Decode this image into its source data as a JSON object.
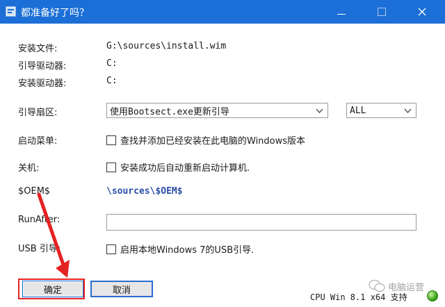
{
  "window": {
    "title": "都准备好了吗？"
  },
  "info": [
    {
      "label": "安装文件:",
      "value": "G:\\sources\\install.wim"
    },
    {
      "label": "引导驱动器:",
      "value": "C:"
    },
    {
      "label": "安装驱动器:",
      "value": "C:"
    }
  ],
  "boot_sector": {
    "label": "引导扇区:",
    "method_selected": "使用Bootsect.exe更新引导",
    "target_selected": "ALL"
  },
  "boot_menu": {
    "label": "启动菜单:",
    "checkbox_text": "查找并添加已经安装在此电脑的Windows版本",
    "checked": false
  },
  "shutdown": {
    "label": "关机:",
    "checkbox_text": "安装成功后自动重新启动计算机.",
    "checked": false
  },
  "oem": {
    "label": "$OEM$",
    "value": "\\sources\\$OEM$"
  },
  "runafter": {
    "label": "RunAfter:",
    "value": ""
  },
  "usb": {
    "label": "USB 引导:",
    "checkbox_text": "启用本地Windows 7的USB引导.",
    "checked": false
  },
  "buttons": {
    "ok": "确定",
    "cancel": "取消"
  },
  "status": {
    "text": "CPU Win 8.1 x64 支持"
  },
  "watermark": {
    "text": "电脑运营"
  },
  "colors": {
    "titlebar": "#1c6fd6",
    "highlight": "#e52222",
    "link": "#2b4ea8",
    "led": "#3aa81a"
  }
}
